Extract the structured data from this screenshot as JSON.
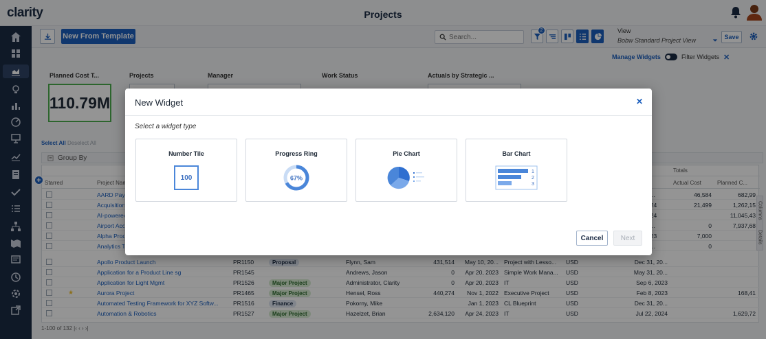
{
  "app": {
    "logo": "clarity",
    "title": "Projects"
  },
  "toolbar": {
    "new_from_template": "New From Template",
    "search_placeholder": "Search...",
    "filter_count": "2",
    "view_label": "View",
    "view_value": "Bobw Standard Project View",
    "save_label": "Save"
  },
  "widgets": {
    "manage": "Manage Widgets",
    "filter": "Filter Widgets",
    "labels": [
      "Planned Cost T...",
      "Projects",
      "Manager",
      "Work Status",
      "Actuals by Strategic ..."
    ],
    "tile_value": "110.79M"
  },
  "grid": {
    "select_all": "Select All",
    "deselect_all": "Deselect All",
    "group_by": "Group By",
    "totals_label": "Totals",
    "headers": {
      "starred": "Starred",
      "project_name": "Project Name",
      "actual_cost": "Actual Cost",
      "planned": "Planned C..."
    },
    "partial_rows": [
      {
        "name": "AARD Paym",
        "date": "0...",
        "actual": "46,584",
        "planned": "682,99"
      },
      {
        "name": "Acquisition",
        "date": "024",
        "actual": "21,499",
        "planned": "1,262,15"
      },
      {
        "name": "AI-powered",
        "date": "024",
        "actual": "",
        "planned": "11,045,43"
      },
      {
        "name": "Airport Acc",
        "date": "0...",
        "actual": "0",
        "planned": "7,937,68"
      },
      {
        "name": "Alpha Prod",
        "date": "023",
        "actual": "7,000",
        "planned": ""
      },
      {
        "name": "Analytics Ta",
        "date": "0...",
        "actual": "0",
        "planned": ""
      }
    ],
    "rows": [
      {
        "name": "Apollo Product Launch",
        "id": "PR1150",
        "tag": "Proposal",
        "tagtype": "proposal",
        "manager": "Flynn, Sam",
        "budget": "431,514",
        "start": "May 10, 20...",
        "type": "Project with Lesso...",
        "currency": "USD",
        "finish": "Dec 31, 20...",
        "actual": "",
        "planned": "",
        "star": ""
      },
      {
        "name": "Application for a Product Line sg",
        "id": "PR1545",
        "tag": "",
        "tagtype": "",
        "manager": "Andrews, Jason",
        "budget": "0",
        "start": "Apr 20, 2023",
        "type": "Simple Work Mana...",
        "currency": "USD",
        "finish": "May 31, 20...",
        "actual": "",
        "planned": "",
        "star": ""
      },
      {
        "name": "Application for Light Mgmt",
        "id": "PR1526",
        "tag": "Major Project",
        "tagtype": "major",
        "manager": "Administrator, Clarity",
        "budget": "0",
        "start": "Apr 20, 2023",
        "type": "IT",
        "currency": "USD",
        "finish": "Sep 6, 2023",
        "actual": "",
        "planned": "",
        "star": ""
      },
      {
        "name": "Aurora Project",
        "id": "PR1465",
        "tag": "Major Project",
        "tagtype": "major",
        "manager": "Hensel, Ross",
        "budget": "440,274",
        "start": "Nov 1, 2022",
        "type": "Executive Project",
        "currency": "USD",
        "finish": "Feb 8, 2023",
        "actual": "",
        "planned": "168,41",
        "star": "★"
      },
      {
        "name": "Automated Testing Framework for XYZ Softw...",
        "id": "PR1516",
        "tag": "Finance",
        "tagtype": "finance",
        "manager": "Pokorny, Mike",
        "budget": "",
        "start": "Jan 1, 2023",
        "type": "CL Blueprint",
        "currency": "USD",
        "finish": "Dec 31, 20...",
        "actual": "",
        "planned": "",
        "star": ""
      },
      {
        "name": "Automation & Robotics",
        "id": "PR1527",
        "tag": "Major Project",
        "tagtype": "major",
        "manager": "Hazelzet, Brian",
        "budget": "2,634,120",
        "start": "Apr 24, 2023",
        "type": "IT",
        "currency": "USD",
        "finish": "Jul 22, 2024",
        "actual": "",
        "planned": "1,629,72",
        "star": ""
      }
    ],
    "pager": "1-100 of 132  |‹  ‹  ›  ›|",
    "side_tabs": [
      "Columns",
      "Details"
    ]
  },
  "modal": {
    "title": "New Widget",
    "subtitle": "Select a widget type",
    "cards": [
      {
        "label": "Number Tile",
        "value": "100"
      },
      {
        "label": "Progress Ring",
        "value": "67%",
        "progress": 0.67
      },
      {
        "label": "Pie Chart"
      },
      {
        "label": "Bar Chart",
        "bars": [
          "1",
          "2",
          "3"
        ]
      }
    ],
    "cancel": "Cancel",
    "next": "Next"
  },
  "colors": {
    "accent": "#1c5fbd",
    "nav": "#1b2b44",
    "tile_border": "#4cae4f"
  }
}
